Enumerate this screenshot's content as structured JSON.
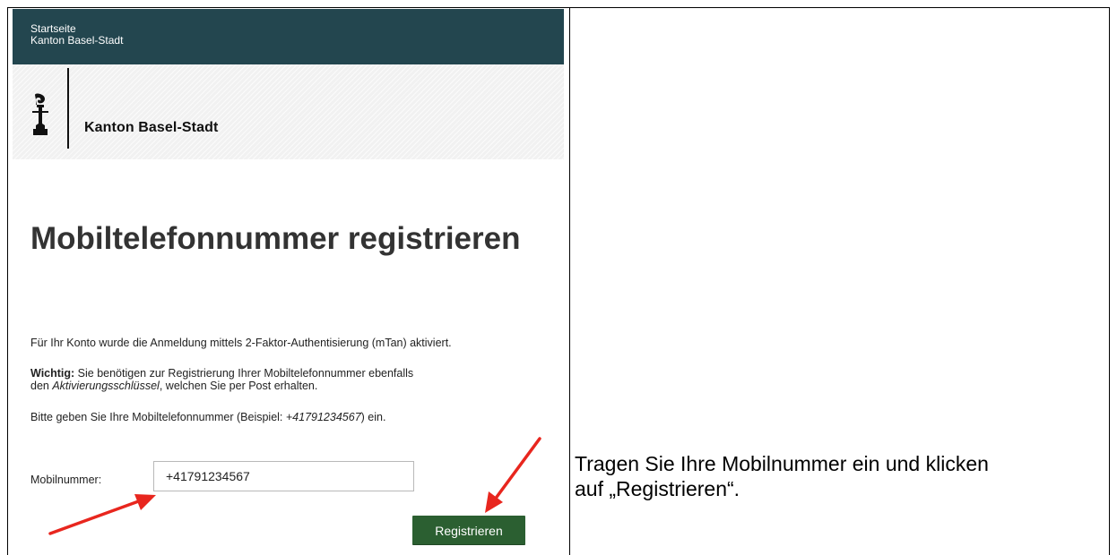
{
  "header": {
    "breadcrumb_home": "Startseite",
    "breadcrumb_canton": "Kanton Basel-Stadt",
    "bar_color": "#23464f"
  },
  "logo": {
    "icon": "basel-staff-icon",
    "text": "Kanton Basel-Stadt"
  },
  "page": {
    "title": "Mobiltelefonnummer registrieren",
    "para1": "Für Ihr Konto wurde die Anmeldung mittels 2-Faktor-Authentisierung (mTan) aktiviert.",
    "para2_bold": "Wichtig:",
    "para2_line1": " Sie benötigen zur Registrierung Ihrer Mobiltelefonnummer ebenfalls",
    "para2_line2_prefix": "den ",
    "para2_italic": "Aktivierungsschlüssel",
    "para2_line2_suffix": ", welchen Sie per Post erhalten.",
    "para3_prefix": "Bitte geben Sie Ihre Mobiltelefonnummer (Beispiel: ",
    "para3_example": "+41791234567",
    "para3_suffix": ") ein."
  },
  "form": {
    "phone_label": "Mobilnummer:",
    "phone_value": "+41791234567",
    "register_label": "Registrieren",
    "button_color": "#2b5f31"
  },
  "annotation": {
    "arrow_color": "#e8261e",
    "instruction_line1": "Tragen Sie Ihre Mobilnummer ein und klicken",
    "instruction_line2": "auf „Registrieren“."
  }
}
